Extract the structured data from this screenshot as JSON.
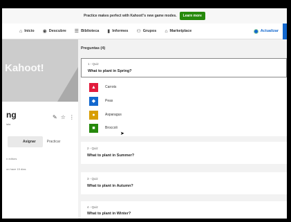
{
  "promo": {
    "text": "Practice makes perfect with Kahoot!'s new game modes.",
    "button": "Learn more"
  },
  "nav": {
    "items": [
      {
        "label": "Inicio",
        "icon": "home-icon",
        "glyph": "⌂"
      },
      {
        "label": "Descubre",
        "icon": "compass-icon",
        "glyph": "◉"
      },
      {
        "label": "Biblioteca",
        "icon": "list-icon",
        "glyph": "☰"
      },
      {
        "label": "Informes",
        "icon": "bar-chart-icon",
        "glyph": "▮"
      },
      {
        "label": "Grupos",
        "icon": "groups-icon",
        "glyph": "⚇"
      },
      {
        "label": "Marketplace",
        "icon": "store-icon",
        "glyph": "⌂"
      }
    ],
    "upgrade": "Actualizar"
  },
  "left": {
    "cover_logo": "Kahoot!",
    "title": "ng",
    "subtitle": "iala",
    "assign": "Asignar",
    "practice": "Practicar",
    "line1": "n editors",
    "line2": "on hace 15 días"
  },
  "questions": {
    "header": "Preguntas (4)",
    "items": [
      {
        "number": "1 - Quiz",
        "text": "What to plant in Spring?",
        "answers": [
          {
            "label": "Carrots",
            "color": "#e21b3c",
            "icon": "triangle-icon",
            "glyph": "▲"
          },
          {
            "label": "Peas",
            "color": "#1368ce",
            "icon": "diamond-icon",
            "glyph": "◆"
          },
          {
            "label": "Asparagus",
            "color": "#d89e00",
            "icon": "circle-icon",
            "glyph": "●"
          },
          {
            "label": "Broccoli",
            "color": "#26890c",
            "icon": "square-icon",
            "glyph": "■"
          }
        ]
      },
      {
        "number": "2 - Quiz",
        "text": "What to plant in Summer?"
      },
      {
        "number": "3 - Quiz",
        "text": "What to plant in Autumn?"
      },
      {
        "number": "4 - Quiz",
        "text": "What to plant in Winter?"
      }
    ]
  }
}
